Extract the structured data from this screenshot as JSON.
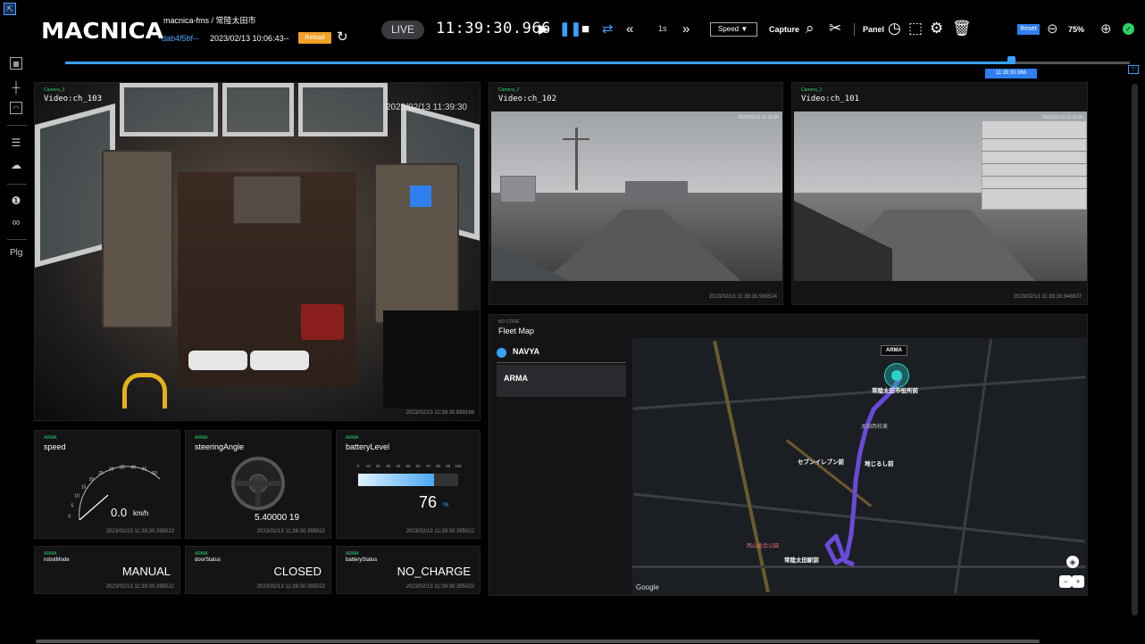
{
  "app": {
    "logo": "MACNICA",
    "project_title": "macnica-fms / 常陸太田市",
    "hash": "dab4f5bf--",
    "date_range": "2023/02/13 10:06:43--",
    "reload_label": "Reload"
  },
  "player": {
    "live_label": "LIVE",
    "clock": "11:39:30.966",
    "step": "1s",
    "speed_label": "Speed ▼",
    "capture_label": "Capture",
    "panel_label": "Panel",
    "reset_label": "Reset",
    "zoom": "75%",
    "timeline_label": "11:39:30.966",
    "timeline_progress": 0.892
  },
  "rail": {
    "plg_label": "Plg"
  },
  "cameras": [
    {
      "sub": "Camera_3",
      "title": "Video:ch_103",
      "overlay_ts": "2023/02/13 11:39:30",
      "ts": "2023/02/13 11:39:30.889166"
    },
    {
      "sub": "Camera_2",
      "title": "Video:ch_102",
      "overlay_ts": "2023/02/13 11:39:30",
      "ts": "2023/02/13 11:39:30.960524"
    },
    {
      "sub": "Camera_2",
      "title": "Video:ch_101",
      "overlay_ts": "2023/02/13 11:39:30",
      "ts": "2023/02/13 11:39:30.946837"
    }
  ],
  "gauges": {
    "speed": {
      "sub": "ARMA",
      "title": "speed",
      "value": "0.0",
      "unit": "km/h",
      "ticks": [
        "0",
        "5",
        "10",
        "15",
        "20",
        "25",
        "30",
        "35",
        "40",
        "45",
        "50"
      ],
      "ts": "2023/02/13 11:39:30.395022"
    },
    "steering": {
      "sub": "ARMA",
      "title": "steeringAngle",
      "value": "5.40000 19",
      "ts": "2023/02/13 11:39:30.395022"
    },
    "battery": {
      "sub": "ARMA",
      "title": "batteryLevel",
      "value": "76",
      "unit": "%",
      "level": 0.76,
      "ticks": [
        "0",
        "10",
        "20",
        "30",
        "40",
        "50",
        "60",
        "70",
        "80",
        "90",
        "100"
      ],
      "ts": "2023/02/13 11:39:30.395022"
    }
  },
  "statuses": [
    {
      "sub": "ARMA",
      "title": "robotMode",
      "value": "MANUAL",
      "ts": "2023/02/13 11:39:30.395022"
    },
    {
      "sub": "ARMA",
      "title": "doorStatus",
      "value": "CLOSED",
      "ts": "2023/02/13 11:39:30.395022"
    },
    {
      "sub": "ARMA",
      "title": "batteryStatus",
      "value": "NO_CHARGE",
      "ts": "2023/02/13 11:39:30.395022"
    }
  ],
  "fleet": {
    "sub": "NO CODE",
    "title": "Fleet Map",
    "group": "NAVYA",
    "vehicle": "ARMA",
    "map_tag": "ARMA",
    "google": "Google",
    "labels": {
      "city_hall": "常陸太田市役所前",
      "seven": "セブンイレブン前",
      "jizo": "地じるし前",
      "station": "常陸太田駅前",
      "school": "太田西校東",
      "park": "西山総合公園"
    }
  }
}
